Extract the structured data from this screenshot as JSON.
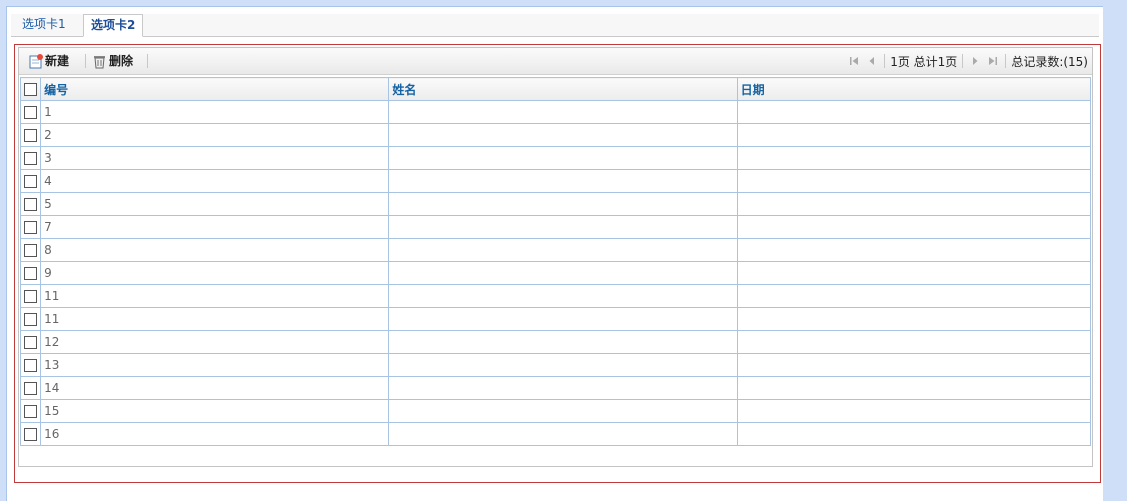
{
  "tabs": [
    {
      "label": "选项卡1"
    },
    {
      "label": "选项卡2"
    }
  ],
  "toolbar": {
    "new_label": "新建",
    "delete_label": "删除",
    "new_icon": "new-document-icon",
    "delete_icon": "trash-icon"
  },
  "pager": {
    "page_info": "1页 总计1页",
    "total_records": "总记录数:(15)"
  },
  "table": {
    "columns": [
      "编号",
      "姓名",
      "日期"
    ],
    "rows": [
      {
        "id": "1",
        "name": "",
        "date": ""
      },
      {
        "id": "2",
        "name": "",
        "date": ""
      },
      {
        "id": "3",
        "name": "",
        "date": ""
      },
      {
        "id": "4",
        "name": "",
        "date": ""
      },
      {
        "id": "5",
        "name": "",
        "date": ""
      },
      {
        "id": "7",
        "name": "",
        "date": ""
      },
      {
        "id": "8",
        "name": "",
        "date": ""
      },
      {
        "id": "9",
        "name": "",
        "date": ""
      },
      {
        "id": "11",
        "name": "",
        "date": ""
      },
      {
        "id": "11",
        "name": "",
        "date": ""
      },
      {
        "id": "12",
        "name": "",
        "date": ""
      },
      {
        "id": "13",
        "name": "",
        "date": ""
      },
      {
        "id": "14",
        "name": "",
        "date": ""
      },
      {
        "id": "15",
        "name": "",
        "date": ""
      },
      {
        "id": "16",
        "name": "",
        "date": ""
      }
    ]
  },
  "colors": {
    "panel_border": "#c0393b",
    "grid_border": "#a7c5e2",
    "header_text": "#1563a3"
  }
}
